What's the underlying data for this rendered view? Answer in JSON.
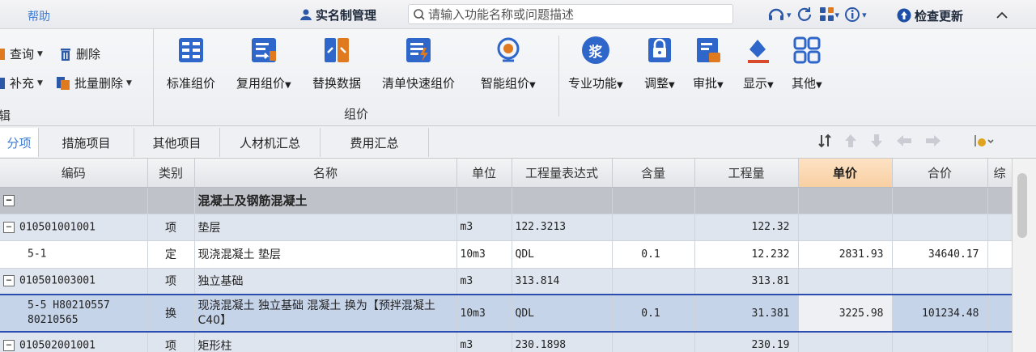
{
  "topbar": {
    "help_label": "帮助",
    "realname_label": "实名制管理",
    "search_placeholder": "请输入功能名称或问题描述",
    "check_update_label": "检查更新"
  },
  "ribbon": {
    "left_buttons": {
      "query": "查询",
      "delete": "删除",
      "supplement": "补充",
      "batch_delete": "批量删除"
    },
    "left_group_label": "辑",
    "group_label": "组价",
    "buttons": [
      {
        "label": "标准组价",
        "icon": "standard-pricing-icon",
        "dropdown": false
      },
      {
        "label": "复用组价",
        "icon": "reuse-pricing-icon",
        "dropdown": true
      },
      {
        "label": "替换数据",
        "icon": "replace-data-icon",
        "dropdown": false
      },
      {
        "label": "清单快速组价",
        "icon": "quick-pricing-icon",
        "dropdown": false
      },
      {
        "label": "智能组价",
        "icon": "smart-pricing-icon",
        "dropdown": true
      },
      {
        "label": "专业功能",
        "icon": "professional-icon",
        "dropdown": true
      },
      {
        "label": "调整",
        "icon": "adjust-icon",
        "dropdown": true
      },
      {
        "label": "审批",
        "icon": "approve-icon",
        "dropdown": true
      },
      {
        "label": "显示",
        "icon": "display-icon",
        "dropdown": true
      },
      {
        "label": "其他",
        "icon": "other-icon",
        "dropdown": true
      }
    ],
    "professional_icon_char": "浆"
  },
  "tabs": [
    {
      "label": "分项",
      "active": true
    },
    {
      "label": "措施项目",
      "active": false
    },
    {
      "label": "其他项目",
      "active": false
    },
    {
      "label": "人材机汇总",
      "active": false
    },
    {
      "label": "费用汇总",
      "active": false
    }
  ],
  "grid": {
    "headers": [
      "编码",
      "类别",
      "名称",
      "单位",
      "工程量表达式",
      "含量",
      "工程量",
      "单价",
      "合价",
      "综"
    ],
    "group_row": {
      "toggle": "−",
      "name": "混凝土及钢筋混凝土"
    },
    "rows": [
      {
        "kind": "qd",
        "toggle": "−",
        "code": "010501001001",
        "type": "项",
        "name": "垫层",
        "unit": "m3",
        "expr": "122.3213",
        "content": "",
        "qty": "122.32",
        "price": "",
        "total": ""
      },
      {
        "kind": "de",
        "code": "5-1",
        "type": "定",
        "name": "现浇混凝土 垫层",
        "unit": "10m3",
        "expr": "QDL",
        "content": "0.1",
        "qty": "12.232",
        "price": "2831.93",
        "total": "34640.17"
      },
      {
        "kind": "qd",
        "toggle": "−",
        "code": "010501003001",
        "type": "项",
        "name": "独立基础",
        "unit": "m3",
        "expr": "313.814",
        "content": "",
        "qty": "313.81",
        "price": "",
        "total": ""
      },
      {
        "kind": "sel",
        "code": "5-5 H80210557 80210565",
        "type": "换",
        "name": "现浇混凝土 独立基础 混凝土  换为【预拌混凝土 C40】",
        "unit": "10m3",
        "expr": "QDL",
        "content": "0.1",
        "qty": "31.381",
        "price": "3225.98",
        "total": "101234.48"
      },
      {
        "kind": "qd",
        "toggle": "−",
        "code": "010502001001",
        "type": "项",
        "name": "矩形柱",
        "unit": "m3",
        "expr": "230.1898",
        "content": "",
        "qty": "230.19",
        "price": "",
        "total": ""
      }
    ]
  },
  "colors": {
    "accent": "#3e7bd1",
    "selection_border": "#2c4db0",
    "header_highlight": "#f8cfa2"
  }
}
